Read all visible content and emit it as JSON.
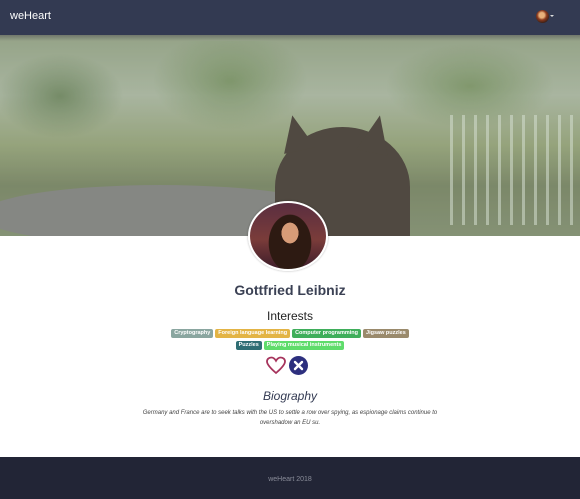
{
  "navbar": {
    "brand": "weHeart",
    "user_menu_icon": "user-avatar-dropdown"
  },
  "profile": {
    "name": "Gottfried Leibniz",
    "interests_title": "Interests",
    "interests": [
      {
        "label": "Cryptography",
        "color": "#8aa6a0"
      },
      {
        "label": "Foreign language learning",
        "color": "#e3b445"
      },
      {
        "label": "Computer programming",
        "color": "#3fae5b"
      },
      {
        "label": "Jigsaw puzzles",
        "color": "#9a8a6c"
      },
      {
        "label": "Puzzles",
        "color": "#2f6e74"
      },
      {
        "label": "Playing musical instruments",
        "color": "#5fdc6b"
      }
    ],
    "actions": {
      "like_icon": "heart-outline-icon",
      "reject_icon": "close-circle-icon",
      "heart_color": "#a6335c",
      "reject_color": "#2d2f7e"
    },
    "bio_title": "Biography",
    "bio_text": "Germany and France are to seek talks with the US to settle a row over spying, as espionage claims continue to overshadow an EU su."
  },
  "footer": {
    "text": "weHeart 2018"
  }
}
